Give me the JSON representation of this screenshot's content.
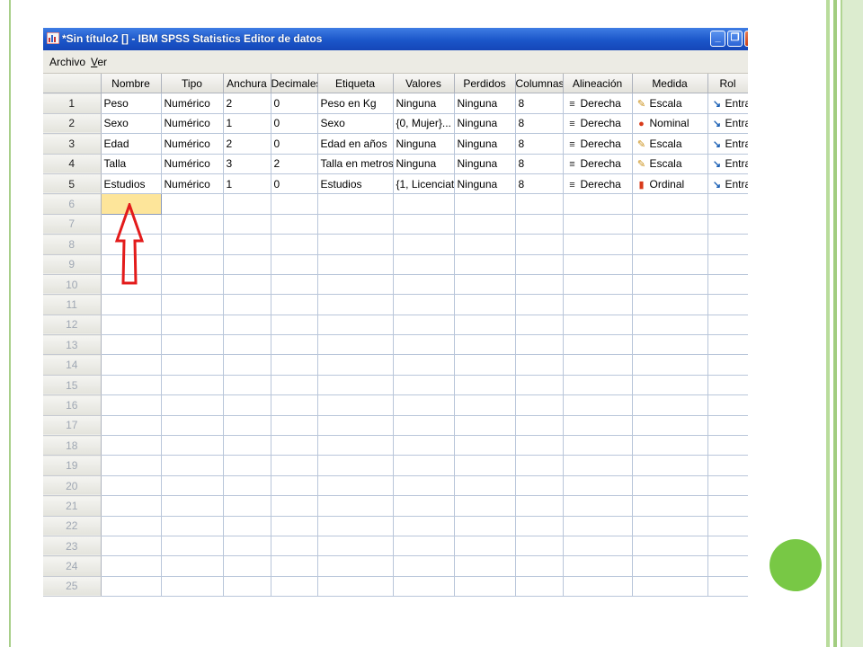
{
  "window": {
    "title": "*Sin título2 [] - IBM SPSS Statistics Editor de datos",
    "minimize_glyph": "_",
    "maximize_glyph": "❐",
    "close_glyph": "✕"
  },
  "menu": [
    "Archivo",
    "Ver"
  ],
  "columns": [
    "Nombre",
    "Tipo",
    "Anchura",
    "Decimales",
    "Etiqueta",
    "Valores",
    "Perdidos",
    "Columnas",
    "Alineación",
    "Medida",
    "Rol"
  ],
  "rows": [
    {
      "num": "1",
      "nombre": "Peso",
      "tipo": "Numérico",
      "anchura": "2",
      "decimales": "0",
      "etiqueta": "Peso en Kg",
      "valores": "Ninguna",
      "perdidos": "Ninguna",
      "columnas": "8",
      "alineacion": "Derecha",
      "medida": "Escala",
      "medida_icon": "ruler-icon",
      "rol": "Entrada"
    },
    {
      "num": "2",
      "nombre": "Sexo",
      "tipo": "Numérico",
      "anchura": "1",
      "decimales": "0",
      "etiqueta": "Sexo",
      "valores": "{0, Mujer}...",
      "perdidos": "Ninguna",
      "columnas": "8",
      "alineacion": "Derecha",
      "medida": "Nominal",
      "medida_icon": "nominal-balls-icon",
      "rol": "Entrada"
    },
    {
      "num": "3",
      "nombre": "Edad",
      "tipo": "Numérico",
      "anchura": "2",
      "decimales": "0",
      "etiqueta": "Edad en años",
      "valores": "Ninguna",
      "perdidos": "Ninguna",
      "columnas": "8",
      "alineacion": "Derecha",
      "medida": "Escala",
      "medida_icon": "ruler-icon",
      "rol": "Entrada"
    },
    {
      "num": "4",
      "nombre": "Talla",
      "tipo": "Numérico",
      "anchura": "3",
      "decimales": "2",
      "etiqueta": "Talla en metros",
      "valores": "Ninguna",
      "perdidos": "Ninguna",
      "columnas": "8",
      "alineacion": "Derecha",
      "medida": "Escala",
      "medida_icon": "ruler-icon",
      "rol": "Entrada"
    },
    {
      "num": "5",
      "nombre": "Estudios",
      "tipo": "Numérico",
      "anchura": "1",
      "decimales": "0",
      "etiqueta": "Estudios",
      "valores": "{1, Licenciat...",
      "perdidos": "Ninguna",
      "columnas": "8",
      "alineacion": "Derecha",
      "medida": "Ordinal",
      "medida_icon": "ordinal-bars-icon",
      "rol": "Entrada"
    }
  ],
  "empty_rows": [
    "6",
    "7",
    "8",
    "9",
    "10",
    "11",
    "12",
    "13",
    "14",
    "15",
    "16",
    "17",
    "18",
    "19",
    "20",
    "21",
    "22",
    "23",
    "24",
    "25"
  ],
  "selected_cell": {
    "row": "6",
    "column": "Nombre"
  },
  "colors": {
    "titlebar": "#1b56c9",
    "selected_cell": "#fde59a",
    "annotation_arrow": "#e31b1b",
    "accent_green": "#78c845"
  }
}
